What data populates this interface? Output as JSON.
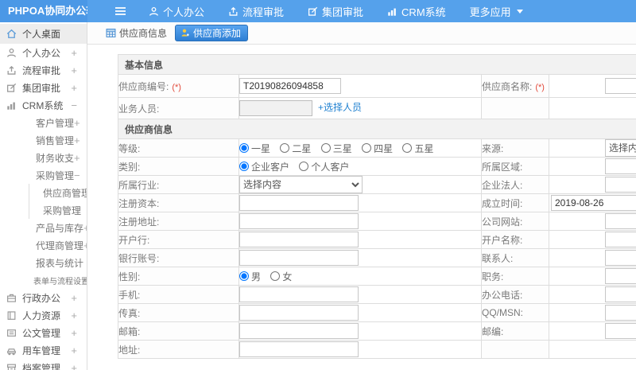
{
  "topbar": {
    "logo": "PHPOA协同办公软件",
    "menu": [
      {
        "label": "个人办公"
      },
      {
        "label": "流程审批"
      },
      {
        "label": "集团审批"
      },
      {
        "label": "CRM系统"
      },
      {
        "label": "更多应用"
      }
    ]
  },
  "tabs": [
    {
      "label": "供应商信息"
    },
    {
      "label": "供应商添加",
      "active": true
    }
  ],
  "sidebar": {
    "items": [
      {
        "label": "个人桌面",
        "expand": ""
      },
      {
        "label": "个人办公",
        "expand": "+"
      },
      {
        "label": "流程审批",
        "expand": "+"
      },
      {
        "label": "集团审批",
        "expand": "+"
      },
      {
        "label": "CRM系统",
        "expand": "−"
      },
      {
        "label": "客户管理",
        "expand": "+"
      },
      {
        "label": "销售管理",
        "expand": "+"
      },
      {
        "label": "财务收支",
        "expand": "+"
      },
      {
        "label": "采购管理",
        "expand": "−"
      },
      {
        "label": "供应商管理",
        "expand": ""
      },
      {
        "label": "采购管理",
        "expand": ""
      },
      {
        "label": "产品与库存",
        "expand": "+"
      },
      {
        "label": "代理商管理",
        "expand": "+"
      },
      {
        "label": "报表与统计",
        "expand": ""
      },
      {
        "label": "表单与流程设置",
        "expand": "+"
      },
      {
        "label": "行政办公",
        "expand": "+"
      },
      {
        "label": "人力资源",
        "expand": "+"
      },
      {
        "label": "公文管理",
        "expand": "+"
      },
      {
        "label": "用车管理",
        "expand": "+"
      },
      {
        "label": "档案管理",
        "expand": "+"
      }
    ]
  },
  "form": {
    "section1_title": "基本信息",
    "section2_title": "供应商信息",
    "required_mark": "(*)",
    "fields": {
      "supplier_no": {
        "label": "供应商编号:",
        "value": "T20190826094858"
      },
      "supplier_name": {
        "label": "供应商名称:",
        "value": ""
      },
      "staff": {
        "label": "业务人员:",
        "value": "",
        "link": "+选择人员"
      },
      "level": {
        "label": "等级:",
        "options": [
          "一星",
          "二星",
          "三星",
          "四星",
          "五星"
        ],
        "selected": "一星"
      },
      "source": {
        "label": "来源:",
        "value": "选择内容"
      },
      "category": {
        "label": "类别:",
        "options": [
          "企业客户",
          "个人客户"
        ],
        "selected": "企业客户"
      },
      "region": {
        "label": "所属区域:",
        "value": ""
      },
      "industry": {
        "label": "所属行业:",
        "value": "选择内容"
      },
      "legal_person": {
        "label": "企业法人:",
        "value": ""
      },
      "capital": {
        "label": "注册资本:",
        "value": ""
      },
      "founded": {
        "label": "成立时间:",
        "value": "2019-08-26"
      },
      "reg_address": {
        "label": "注册地址:",
        "value": ""
      },
      "website": {
        "label": "公司网站:",
        "value": ""
      },
      "bank": {
        "label": "开户行:",
        "value": ""
      },
      "account_name": {
        "label": "开户名称:",
        "value": ""
      },
      "bank_no": {
        "label": "银行账号:",
        "value": ""
      },
      "contact": {
        "label": "联系人:",
        "value": ""
      },
      "gender": {
        "label": "性别:",
        "options": [
          "男",
          "女"
        ],
        "selected": "男"
      },
      "position": {
        "label": "职务:",
        "value": ""
      },
      "mobile": {
        "label": "手机:",
        "value": ""
      },
      "office_tel": {
        "label": "办公电话:",
        "value": ""
      },
      "fax": {
        "label": "传真:",
        "value": ""
      },
      "qq": {
        "label": "QQ/MSN:",
        "value": ""
      },
      "email": {
        "label": "邮箱:",
        "value": ""
      },
      "zip": {
        "label": "邮编:",
        "value": ""
      },
      "address": {
        "label": "地址:",
        "value": ""
      }
    }
  }
}
